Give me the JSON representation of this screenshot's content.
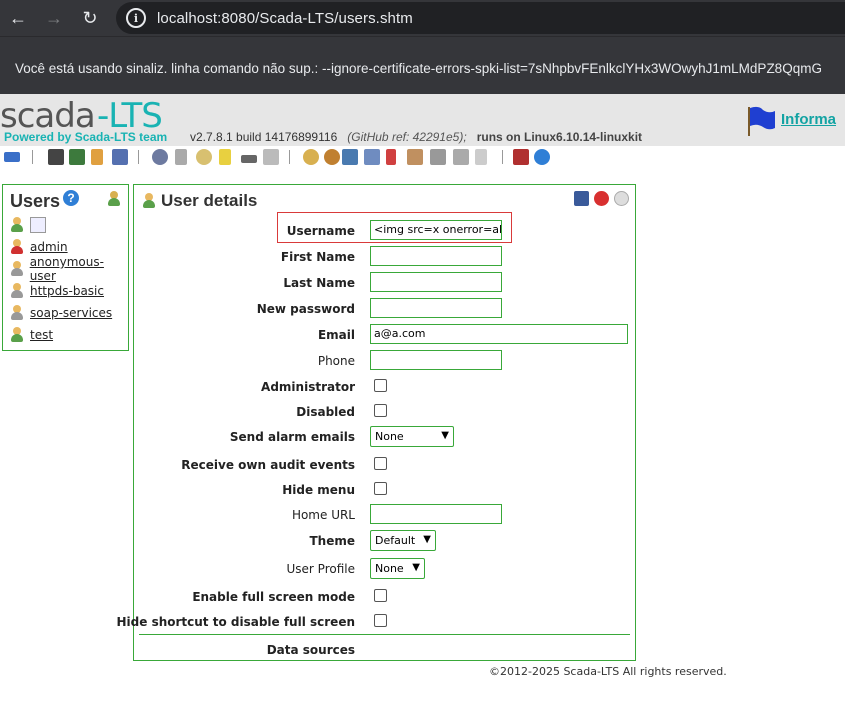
{
  "browser": {
    "url": "localhost:8080/Scada-LTS/users.shtm",
    "infobar_text": "Você está usando sinaliz. linha comando não sup.: --ignore-certificate-errors-spki-list=7sNhpbvFEnlkclYHx3WOwyhJ1mLMdPZ8QqmG"
  },
  "header": {
    "logo_text": "scada-LTS",
    "powered_by": "Powered by Scada-LTS team",
    "version": "v2.7.8.1 build 14176899116",
    "github_ref": "(GitHub ref: 42291e5);",
    "runs_on": "runs on Linux6.10.14-linuxkit",
    "info_link": "Informa"
  },
  "users_panel": {
    "title": "Users",
    "users": [
      {
        "name": "",
        "role": "normal"
      },
      {
        "name": "admin",
        "role": "admin"
      },
      {
        "name": "anonymous-user",
        "role": "disabled"
      },
      {
        "name": "httpds-basic",
        "role": "disabled"
      },
      {
        "name": "soap-services",
        "role": "disabled"
      },
      {
        "name": "test",
        "role": "normal"
      }
    ]
  },
  "details": {
    "title": "User details",
    "username_label": "Username",
    "username_value": "<img src=x onerror=alert(",
    "firstname_label": "First Name",
    "firstname_value": "",
    "lastname_label": "Last Name",
    "lastname_value": "",
    "password_label": "New password",
    "password_value": "",
    "email_label": "Email",
    "email_value": "a@a.com",
    "phone_label": "Phone",
    "phone_value": "",
    "admin_label": "Administrator",
    "disabled_label": "Disabled",
    "alarm_label": "Send alarm emails",
    "alarm_value": "None",
    "audit_label": "Receive own audit events",
    "hidemenu_label": "Hide menu",
    "homeurl_label": "Home URL",
    "homeurl_value": "",
    "theme_label": "Theme",
    "theme_value": "Default",
    "profile_label": "User Profile",
    "profile_value": "None",
    "fullscreen_label": "Enable full screen mode",
    "hideshortcut_label": "Hide shortcut to disable full screen",
    "datasources_label": "Data sources"
  },
  "footer": {
    "copyright": "©2012-2025 Scada-LTS All rights reserved."
  },
  "colors": {
    "accent_green": "#39a839",
    "brand_teal": "#19b3b3",
    "highlight_red": "#d93a3a"
  }
}
